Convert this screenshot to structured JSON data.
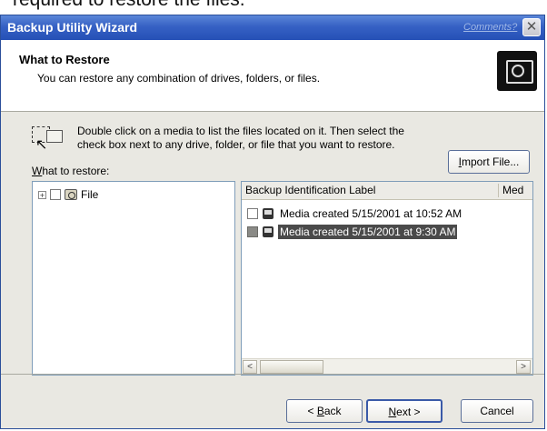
{
  "caption": "required to restore the files.",
  "window": {
    "title": "Backup Utility Wizard",
    "comments_link": "Comments?",
    "close_glyph": "✕"
  },
  "header": {
    "title": "What to Restore",
    "subtitle": "You can restore any combination of drives, folders, or files."
  },
  "instruction": {
    "line1": "Double click on a media to list the files located on it. Then select the",
    "line2": "check box next to any drive, folder, or file that you want to restore."
  },
  "what_to_restore": {
    "label_prefix": "",
    "label_underlined": "W",
    "label_rest": "hat to restore:"
  },
  "import_button": {
    "underlined": "I",
    "rest": "mport File..."
  },
  "tree": {
    "items": [
      {
        "expander": "+",
        "label": "File"
      }
    ]
  },
  "list": {
    "columns": [
      "Backup Identification Label",
      "Med"
    ],
    "rows": [
      {
        "label": "Media created 5/15/2001 at 10:52 AM",
        "selected": false
      },
      {
        "label": "Media created 5/15/2001 at 9:30 AM",
        "selected": true
      }
    ],
    "scroll_left": "<",
    "scroll_right": ">"
  },
  "footer": {
    "back_pre": "< ",
    "back_u": "B",
    "back_rest": "ack",
    "next_u": "N",
    "next_rest": "ext >",
    "cancel": "Cancel"
  },
  "icons": {
    "header": "backup-media-icon",
    "hint": "drag-pointer-icon",
    "tree_item": "file-media-icon",
    "rows": "media-icon"
  }
}
